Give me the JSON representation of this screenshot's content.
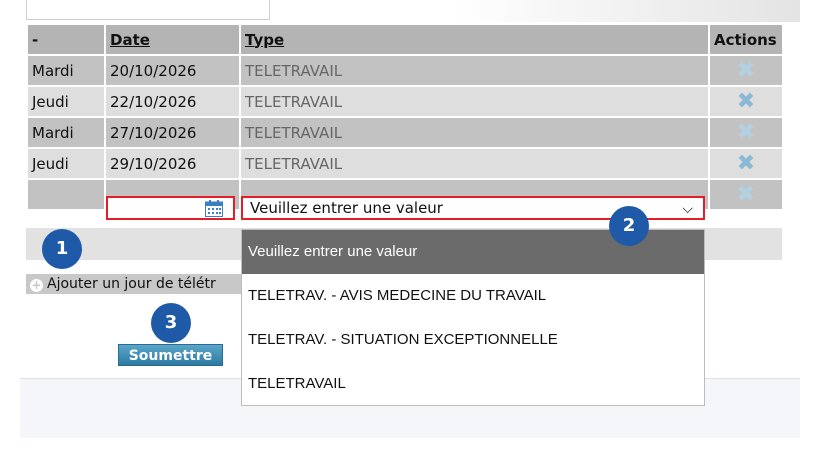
{
  "table": {
    "headers": {
      "dash": "-",
      "date": "Date",
      "type": "Type",
      "actions": "Actions"
    },
    "rows": [
      {
        "day": "Mardi",
        "date": "20/10/2026",
        "type": "TELETRAVAIL"
      },
      {
        "day": "Jeudi",
        "date": "22/10/2026",
        "type": "TELETRAVAIL"
      },
      {
        "day": "Mardi",
        "date": "27/10/2026",
        "type": "TELETRAVAIL"
      },
      {
        "day": "Jeudi",
        "date": "29/10/2026",
        "type": "TELETRAVAIL"
      }
    ],
    "delete_icon": "close-x-icon"
  },
  "new_row": {
    "date_value": "",
    "calendar_icon": "calendar-icon",
    "type_select_value": "Veuillez entrer une valeur",
    "chevron_icon": "chevron-down-icon"
  },
  "dropdown": {
    "options": [
      "Veuillez entrer une valeur",
      "TELETRAV. - AVIS MEDECINE DU TRAVAIL",
      "TELETRAV. - SITUATION EXCEPTIONNELLE",
      "TELETRAVAIL"
    ],
    "selected_index": 0
  },
  "add_link": {
    "label": "Ajouter un jour de télétr",
    "icon": "plus-icon"
  },
  "submit": {
    "label": "Soumettre"
  },
  "badges": {
    "one": "1",
    "two": "2",
    "three": "3"
  },
  "colors": {
    "highlight": "#e41e26",
    "badge": "#1f5aa8",
    "selected_option": "#6b6b6b"
  }
}
